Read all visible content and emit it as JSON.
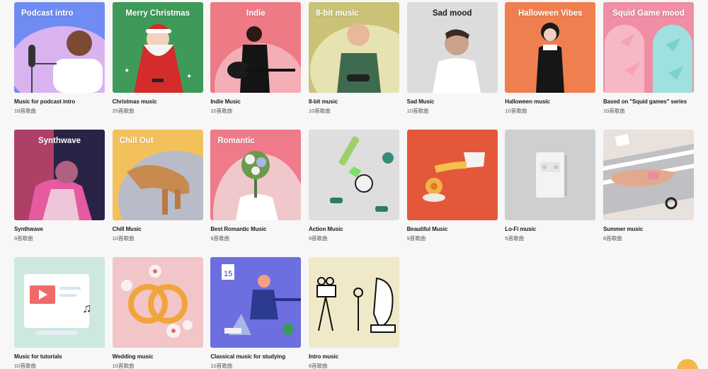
{
  "playlists": [
    {
      "cover_title": "Podcast intro",
      "name": "Music for podcast intro",
      "count": "18首歌曲"
    },
    {
      "cover_title": "Merry Christmas",
      "name": "Christmas music",
      "count": "25首歌曲"
    },
    {
      "cover_title": "Indie",
      "name": "Indie Music",
      "count": "10首歌曲"
    },
    {
      "cover_title": "8-bit music",
      "name": "8-bit music",
      "count": "10首歌曲"
    },
    {
      "cover_title": "Sad mood",
      "name": "Sad Music",
      "count": "10首歌曲"
    },
    {
      "cover_title": "Halloween Vibes",
      "name": "Halloween music",
      "count": "10首歌曲"
    },
    {
      "cover_title": "Squid Game mood",
      "name": "Based on \"Squid games\" series",
      "count": "10首歌曲"
    },
    {
      "cover_title": "Synthwave",
      "name": "Synthwave",
      "count": "9首歌曲"
    },
    {
      "cover_title": "Chill Out",
      "name": "Chill Music",
      "count": "10首歌曲"
    },
    {
      "cover_title": "Romantic",
      "name": "Best Romantic Music",
      "count": "9首歌曲"
    },
    {
      "cover_title": "",
      "name": "Action Music",
      "count": "9首歌曲"
    },
    {
      "cover_title": "",
      "name": "Beautiful Music",
      "count": "9首歌曲"
    },
    {
      "cover_title": "",
      "name": "Lo-Fi music",
      "count": "5首歌曲"
    },
    {
      "cover_title": "",
      "name": "Summer music",
      "count": "8首歌曲"
    },
    {
      "cover_title": "",
      "name": "Music for tutorials",
      "count": "10首歌曲"
    },
    {
      "cover_title": "",
      "name": "Wedding music",
      "count": "10首歌曲"
    },
    {
      "cover_title": "",
      "name": "Classical music for studying",
      "count": "10首歌曲"
    },
    {
      "cover_title": "",
      "name": "Intro music",
      "count": "8首歌曲"
    }
  ],
  "colors": {
    "accent_fab": "#f2b84b",
    "podcast": "#6f8cf2",
    "christmas": "#3f9a59",
    "indie": "#ee7a86",
    "eightbit": "#c9c277",
    "sad": "#dcdcdc",
    "halloween": "#ef7f4f",
    "squid": "#ef8ea5",
    "synthwave": "#2a2346",
    "chill": "#f3c15c",
    "romantic": "#ee7a8a",
    "action": "#dedede",
    "beautiful": "#e4583a",
    "lofi": "#cfcfcf",
    "summer": "#e9e1dc",
    "tutorials": "#cde9dd",
    "wedding": "#f2c5c8",
    "classical": "#6d6ee0",
    "intro": "#f0e9c8"
  }
}
